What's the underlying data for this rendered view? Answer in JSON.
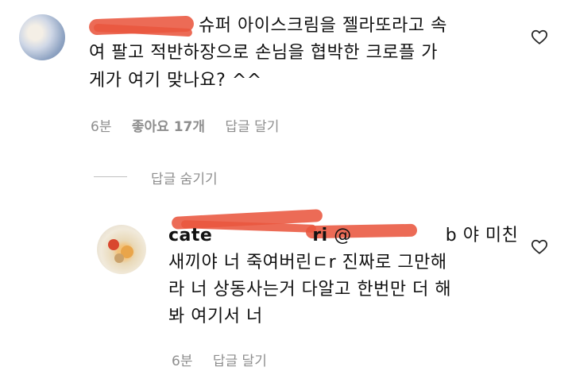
{
  "comment1": {
    "text_line1": "슈퍼 아이스크림을 젤라또라고 속",
    "text_line2": "여 팔고 적반하장으로 손님을 협박한 크로플 가",
    "text_line3": "게가 여기 맞나요? ^^",
    "time": "6분",
    "likes": "좋아요 17개",
    "reply": "답글 달기",
    "like_icon": "heart-outline-icon"
  },
  "hide_replies": "답글 숨기기",
  "comment2": {
    "username_visible": "cate",
    "username_suffix": "ri",
    "mention_start": "@",
    "mention_end": "b",
    "text_line1_tail": "야 미친",
    "text_line2": "새끼야 너 죽여버린ㄷr 진짜로 그만해",
    "text_line3": "라 너 상동사는거 다알고 한번만 더 해",
    "text_line4": "봐 여기서 너",
    "time": "6분",
    "reply": "답글 달기",
    "like_icon": "heart-outline-icon"
  },
  "colors": {
    "redaction": "#e9573f",
    "meta_gray": "#8e8e8e"
  }
}
